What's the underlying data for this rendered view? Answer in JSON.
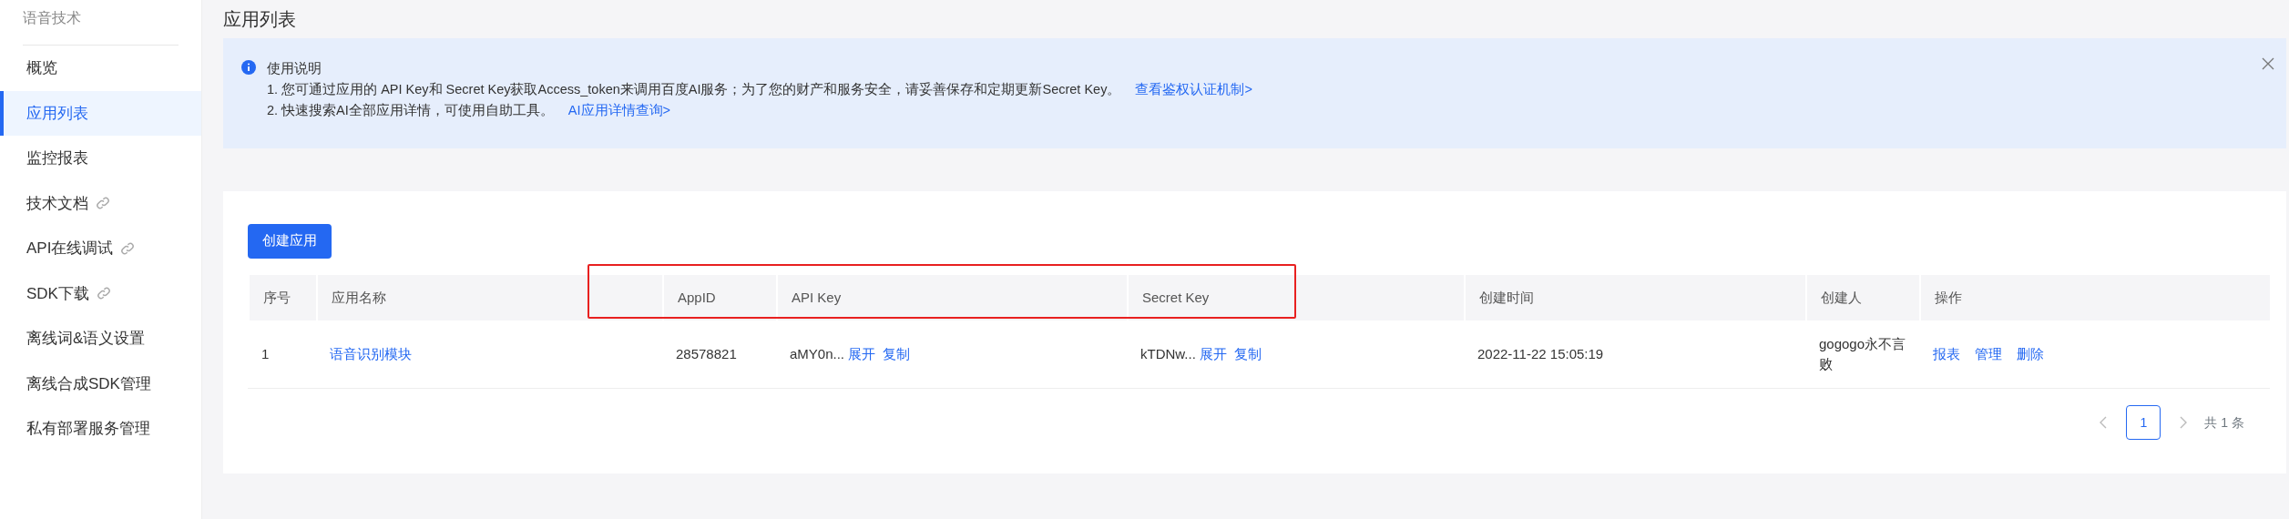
{
  "sidebar": {
    "title": "语音技术",
    "items": [
      {
        "label": "概览",
        "selected": false,
        "external": false
      },
      {
        "label": "应用列表",
        "selected": true,
        "external": false
      },
      {
        "label": "监控报表",
        "selected": false,
        "external": false
      },
      {
        "label": "技术文档",
        "selected": false,
        "external": true
      },
      {
        "label": "API在线调试",
        "selected": false,
        "external": true
      },
      {
        "label": "SDK下载",
        "selected": false,
        "external": true
      },
      {
        "label": "离线词&语义设置",
        "selected": false,
        "external": false
      },
      {
        "label": "离线合成SDK管理",
        "selected": false,
        "external": false
      },
      {
        "label": "私有部署服务管理",
        "selected": false,
        "external": false
      }
    ]
  },
  "page_title": "应用列表",
  "notice": {
    "title": "使用说明",
    "lines": [
      {
        "text": "1. 您可通过应用的 API Key和 Secret Key获取Access_token来调用百度AI服务；为了您的财产和服务安全，请妥善保存和定期更新Secret Key。",
        "link": "查看鉴权认证机制>"
      },
      {
        "text": "2. 快速搜索AI全部应用详情，可使用自助工具。",
        "link": "AI应用详情查询>"
      }
    ]
  },
  "create_button": "创建应用",
  "table": {
    "columns": [
      "序号",
      "应用名称",
      "AppID",
      "API Key",
      "Secret Key",
      "创建时间",
      "创建人",
      "操作"
    ],
    "rows": [
      {
        "index": "1",
        "name": "语音识别模块",
        "app_id": "28578821",
        "api_key": {
          "value": "aMY0n...",
          "expand": "展开",
          "copy": "复制"
        },
        "secret_key": {
          "value": "kTDNw...",
          "expand": "展开",
          "copy": "复制"
        },
        "created": "2022-11-22 15:05:19",
        "creator": "gogogo永不言败",
        "actions": [
          "报表",
          "管理",
          "删除"
        ]
      }
    ]
  },
  "pagination": {
    "pages": [
      {
        "label": "1",
        "selected": true
      }
    ],
    "total": "共 1 条"
  }
}
